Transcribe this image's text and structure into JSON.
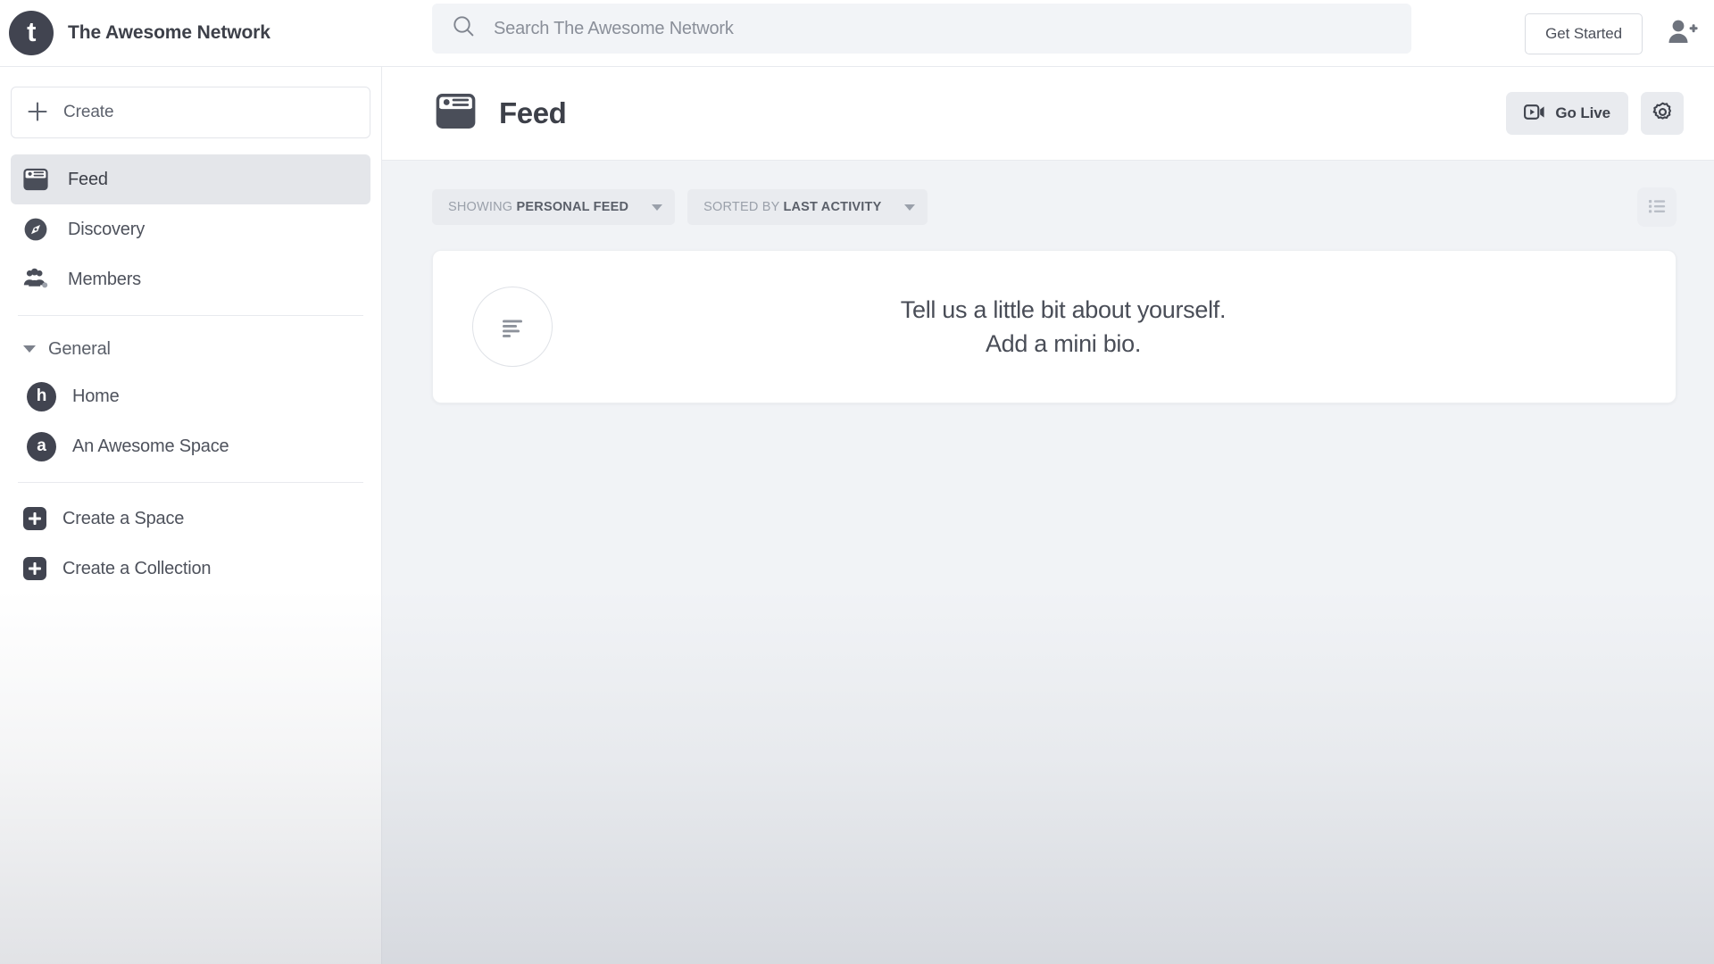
{
  "topbar": {
    "logo_letter": "t",
    "brand_name": "The Awesome Network",
    "search": {
      "icon": "search-icon",
      "placeholder": "Search The Awesome Network",
      "value": ""
    },
    "get_started_label": "Get Started",
    "add_person_icon": "add-person-icon"
  },
  "sidebar": {
    "create_button": {
      "label": "Create",
      "icon": "plus-icon"
    },
    "nav": [
      {
        "label": "Feed",
        "icon": "feed-icon",
        "active": true
      },
      {
        "label": "Discovery",
        "icon": "compass-icon",
        "active": false
      },
      {
        "label": "Members",
        "icon": "members-icon",
        "active": false
      }
    ],
    "section": {
      "title": "General",
      "caret_icon": "chevron-down-icon",
      "spaces": [
        {
          "label": "Home",
          "avatar_letter": "h"
        },
        {
          "label": "An Awesome Space",
          "avatar_letter": "a"
        }
      ]
    },
    "creators": [
      {
        "label": "Create a Space",
        "icon": "plus-square-icon"
      },
      {
        "label": "Create a Collection",
        "icon": "plus-square-icon"
      }
    ]
  },
  "main": {
    "header": {
      "icon": "feed-icon",
      "title": "Feed",
      "go_live": {
        "label": "Go Live",
        "icon": "video-camera-icon"
      },
      "settings": {
        "icon": "gear-icon"
      }
    },
    "filters": [
      {
        "name": "showing",
        "label": "SHOWING",
        "value": "PERSONAL FEED",
        "caret_icon": "chevron-down-icon"
      },
      {
        "name": "sorted-by",
        "label": "SORTED BY",
        "value": "LAST ACTIVITY",
        "caret_icon": "chevron-down-icon"
      }
    ],
    "view_toggle": {
      "icon": "list-view-icon"
    },
    "bio_card": {
      "icon": "text-lines-icon",
      "line1": "Tell us a little bit about yourself.",
      "line2": "Add a mini bio."
    }
  },
  "colors": {
    "brand_dark": "#414450",
    "page_bg": "#f1f3f6",
    "panel_bg": "#ffffff",
    "active_item_bg": "#e4e6ea",
    "chip_bg": "#e9ebef",
    "text_primary": "#3d4049",
    "text_secondary": "#5a5f69",
    "text_muted": "#9aa0aa",
    "border": "#e8eaee"
  }
}
